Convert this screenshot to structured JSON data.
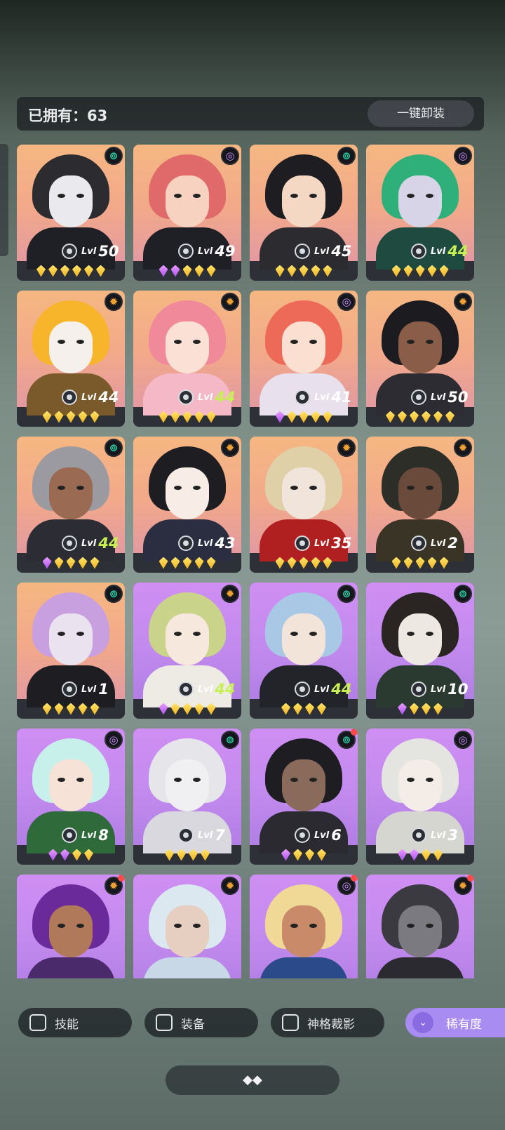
{
  "header": {
    "owned_label": "已拥有：63",
    "unequip_all_label": "一键卸装"
  },
  "colors": {
    "element_green": "#27d6a8",
    "element_purple": "#c98cff",
    "element_orange": "#f0a030",
    "level_green": "#c8ef54",
    "rarity_accent": "#a98cf2"
  },
  "heroes": [
    {
      "bg": "orange",
      "element": "green",
      "level": "50",
      "level_green": false,
      "gems": [
        "gold",
        "gold",
        "gold",
        "gold",
        "gold",
        "gold"
      ],
      "notify": false,
      "hair": "#2b2b30",
      "skin": "#e9e9ee",
      "cloth": "#1f1f26"
    },
    {
      "bg": "orange",
      "element": "purple",
      "level": "49",
      "level_green": false,
      "gems": [
        "purple",
        "purple",
        "gold",
        "gold",
        "gold"
      ],
      "notify": false,
      "hair": "#e06a6a",
      "skin": "#f7d2c0",
      "cloth": "#1f1f26"
    },
    {
      "bg": "orange",
      "element": "green",
      "level": "45",
      "level_green": false,
      "gems": [
        "gold",
        "gold",
        "gold",
        "gold",
        "gold"
      ],
      "notify": false,
      "hair": "#1d1d22",
      "skin": "#f4d8c4",
      "cloth": "#2b2b30"
    },
    {
      "bg": "orange",
      "element": "purple",
      "level": "44",
      "level_green": true,
      "gems": [
        "gold",
        "gold",
        "gold",
        "gold",
        "gold"
      ],
      "notify": false,
      "hair": "#2fb07a",
      "skin": "#d7d4e8",
      "cloth": "#1e4a40"
    },
    {
      "bg": "orange",
      "element": "orange",
      "level": "44",
      "level_green": false,
      "gems": [
        "gold",
        "gold",
        "gold",
        "gold",
        "gold"
      ],
      "notify": false,
      "hair": "#f7b52c",
      "skin": "#f5f0ec",
      "cloth": "#7a5a2a"
    },
    {
      "bg": "orange",
      "element": "orange",
      "level": "44",
      "level_green": true,
      "gems": [
        "gold",
        "gold",
        "gold",
        "gold",
        "gold"
      ],
      "notify": false,
      "hair": "#f08a9a",
      "skin": "#fbe0d6",
      "cloth": "#f4b8c6"
    },
    {
      "bg": "orange",
      "element": "purple",
      "level": "41",
      "level_green": false,
      "gems": [
        "purple",
        "gold",
        "gold",
        "gold",
        "gold"
      ],
      "notify": false,
      "hair": "#ee6a58",
      "skin": "#fbe0d2",
      "cloth": "#e9e0ee"
    },
    {
      "bg": "orange",
      "element": "orange",
      "level": "50",
      "level_green": false,
      "gems": [
        "gold",
        "gold",
        "gold",
        "gold",
        "gold",
        "gold"
      ],
      "notify": false,
      "hair": "#1c1c20",
      "skin": "#8a5d48",
      "cloth": "#2c2c32"
    },
    {
      "bg": "orange",
      "element": "green",
      "level": "44",
      "level_green": true,
      "gems": [
        "purple",
        "gold",
        "gold",
        "gold",
        "gold"
      ],
      "notify": false,
      "hair": "#9a9aa0",
      "skin": "#9a6a52",
      "cloth": "#2c2c34"
    },
    {
      "bg": "orange",
      "element": "orange",
      "level": "43",
      "level_green": false,
      "gems": [
        "gold",
        "gold",
        "gold",
        "gold",
        "gold"
      ],
      "notify": false,
      "hair": "#1d1d22",
      "skin": "#f7ece6",
      "cloth": "#2a2e40"
    },
    {
      "bg": "orange",
      "element": "orange",
      "level": "35",
      "level_green": false,
      "gems": [
        "gold",
        "gold",
        "gold",
        "gold",
        "gold"
      ],
      "notify": false,
      "hair": "#e0d0a8",
      "skin": "#f1e4da",
      "cloth": "#b02020"
    },
    {
      "bg": "orange",
      "element": "orange",
      "level": "2",
      "level_green": false,
      "gems": [
        "gold",
        "gold",
        "gold",
        "gold",
        "gold"
      ],
      "notify": false,
      "hair": "#2e2e28",
      "skin": "#6a4a3a",
      "cloth": "#3a3426"
    },
    {
      "bg": "orange",
      "element": "green",
      "level": "1",
      "level_green": false,
      "gems": [
        "gold",
        "gold",
        "gold",
        "gold",
        "gold"
      ],
      "notify": false,
      "hair": "#c8a0e0",
      "skin": "#eae2ee",
      "cloth": "#1d1d22"
    },
    {
      "bg": "purple",
      "element": "orange",
      "level": "44",
      "level_green": true,
      "gems": [
        "purple",
        "gold",
        "gold",
        "gold",
        "gold"
      ],
      "notify": false,
      "hair": "#c9d48a",
      "skin": "#f6e8dc",
      "cloth": "#eeeae4"
    },
    {
      "bg": "purple",
      "element": "green",
      "level": "44",
      "level_green": true,
      "gems": [
        "gold",
        "gold",
        "gold",
        "gold"
      ],
      "notify": false,
      "hair": "#a8c8e6",
      "skin": "#f3e4da",
      "cloth": "#22242a"
    },
    {
      "bg": "purple",
      "element": "green",
      "level": "10",
      "level_green": false,
      "gems": [
        "purple",
        "gold",
        "gold",
        "gold"
      ],
      "notify": false,
      "hair": "#2a2422",
      "skin": "#eee8e2",
      "cloth": "#2a3a30"
    },
    {
      "bg": "purple",
      "element": "purple",
      "level": "8",
      "level_green": false,
      "gems": [
        "purple",
        "purple",
        "gold",
        "gold"
      ],
      "notify": false,
      "hair": "#c8f0ea",
      "skin": "#f6e2d6",
      "cloth": "#2e6a3a"
    },
    {
      "bg": "purple",
      "element": "green",
      "level": "7",
      "level_green": false,
      "gems": [
        "gold",
        "gold",
        "gold",
        "gold"
      ],
      "notify": false,
      "hair": "#e6e6ea",
      "skin": "#f0f0f2",
      "cloth": "#d8d8de"
    },
    {
      "bg": "purple",
      "element": "green",
      "level": "6",
      "level_green": false,
      "gems": [
        "purple",
        "gold",
        "gold",
        "gold"
      ],
      "notify": true,
      "hair": "#1d1d22",
      "skin": "#8a6a5a",
      "cloth": "#2a2a30"
    },
    {
      "bg": "purple",
      "element": "purple",
      "level": "3",
      "level_green": false,
      "gems": [
        "purple",
        "purple",
        "gold",
        "gold"
      ],
      "notify": false,
      "hair": "#e4e4e0",
      "skin": "#f4ece6",
      "cloth": "#d6d6d0"
    },
    {
      "bg": "purple",
      "element": "orange",
      "level": "",
      "level_green": false,
      "gems": [],
      "notify": true,
      "hair": "#6a2a9a",
      "skin": "#b07a5a",
      "cloth": "#4a2a6a"
    },
    {
      "bg": "purple",
      "element": "orange",
      "level": "",
      "level_green": false,
      "gems": [],
      "notify": false,
      "hair": "#dce8f0",
      "skin": "#e6cfc0",
      "cloth": "#c8d8e6"
    },
    {
      "bg": "purple",
      "element": "purple",
      "level": "",
      "level_green": false,
      "gems": [],
      "notify": true,
      "hair": "#f0d896",
      "skin": "#c98a6a",
      "cloth": "#2a4a8a"
    },
    {
      "bg": "purple",
      "element": "orange",
      "level": "",
      "level_green": false,
      "gems": [],
      "notify": true,
      "hair": "#3a3a40",
      "skin": "#7a7a80",
      "cloth": "#2a2a30"
    }
  ],
  "level_prefix": "Lvl",
  "filters": {
    "skill_label": "技能",
    "equipment_label": "装备",
    "divine_label": "神格裁影",
    "rarity_label": "稀有度",
    "rarity_icon": "double-chevron-down-icon"
  },
  "bottom": {
    "handle_icon": "expand-icon",
    "handle_glyph": "◆◆"
  }
}
